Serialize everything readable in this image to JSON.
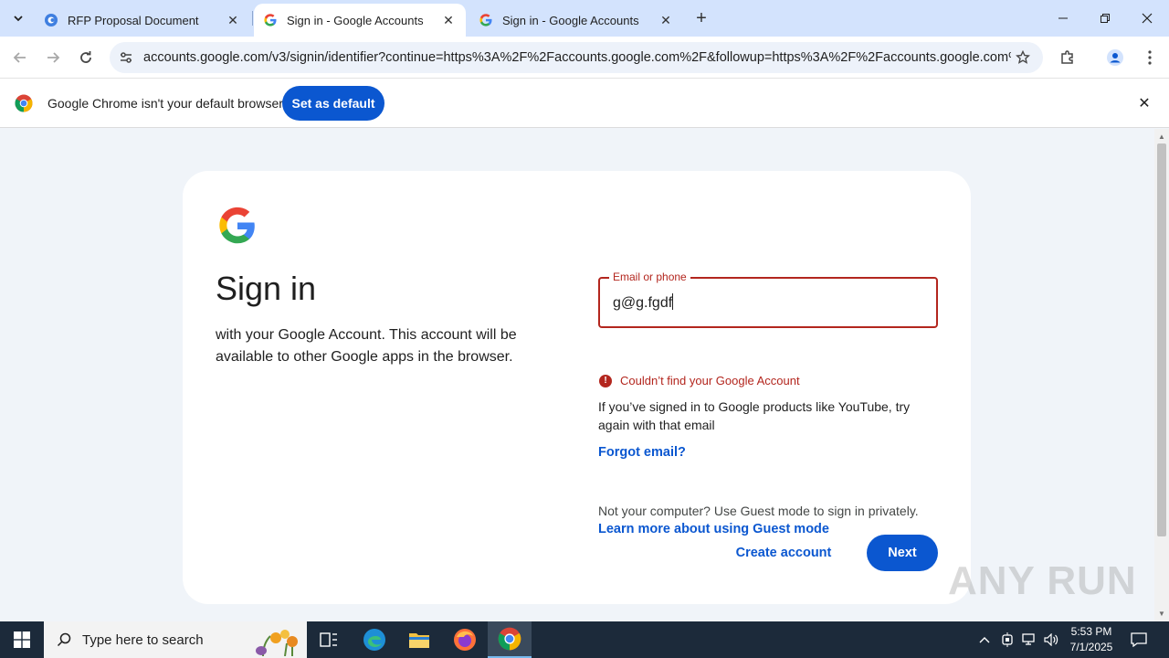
{
  "browser": {
    "tabs": [
      {
        "title": "RFP Proposal Document",
        "active": false
      },
      {
        "title": "Sign in - Google Accounts",
        "active": true
      },
      {
        "title": "Sign in - Google Accounts",
        "active": false
      }
    ],
    "url": "accounts.google.com/v3/signin/identifier?continue=https%3A%2F%2Faccounts.google.com%2F&followup=https%3A%2F%2Faccounts.google.com%2..."
  },
  "infobar": {
    "message": "Google Chrome isn't your default browser",
    "button_label": "Set as default"
  },
  "signin": {
    "title": "Sign in",
    "subtitle": "with your Google Account. This account will be available to other Google apps in the browser.",
    "field_label": "Email or phone",
    "field_value": "g@g.fgdf",
    "error_text": "Couldn’t find your Google Account",
    "hint": "If you’ve signed in to Google products like YouTube, try again with that email",
    "forgot_email": "Forgot email?",
    "guest_text": "Not your computer? Use Guest mode to sign in privately.",
    "guest_link": "Learn more about using Guest mode",
    "create_account": "Create account",
    "next": "Next"
  },
  "watermark": "ANY RUN",
  "taskbar": {
    "search_placeholder": "Type here to search",
    "time": "5:53 PM",
    "date": "7/1/2025"
  },
  "colors": {
    "accent": "#0b57d0",
    "error": "#b3261e",
    "tabstrip": "#d3e3fd",
    "page_bg": "#f0f4f9"
  }
}
